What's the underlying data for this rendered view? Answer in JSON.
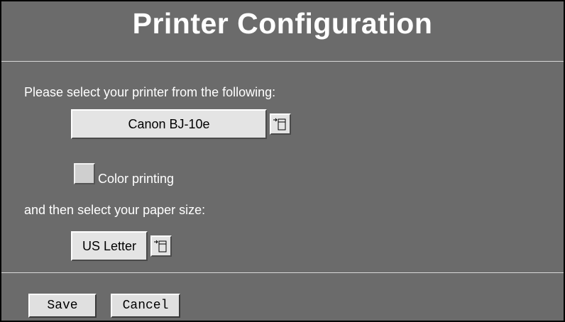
{
  "window": {
    "title": "Printer Configuration"
  },
  "printer": {
    "prompt": "Please select your printer from the following:",
    "selected": "Canon BJ-10e",
    "color_option_label": "Color printing",
    "color_option_checked": false
  },
  "paper": {
    "prompt": "and then select your paper size:",
    "selected": "US Letter"
  },
  "actions": {
    "save_label": "Save",
    "cancel_label": "Cancel"
  },
  "icons": {
    "option_menu": "option-menu-icon"
  },
  "colors": {
    "background": "#6b6b6b",
    "button_face": "#e4e4e4",
    "text": "#ffffff"
  }
}
